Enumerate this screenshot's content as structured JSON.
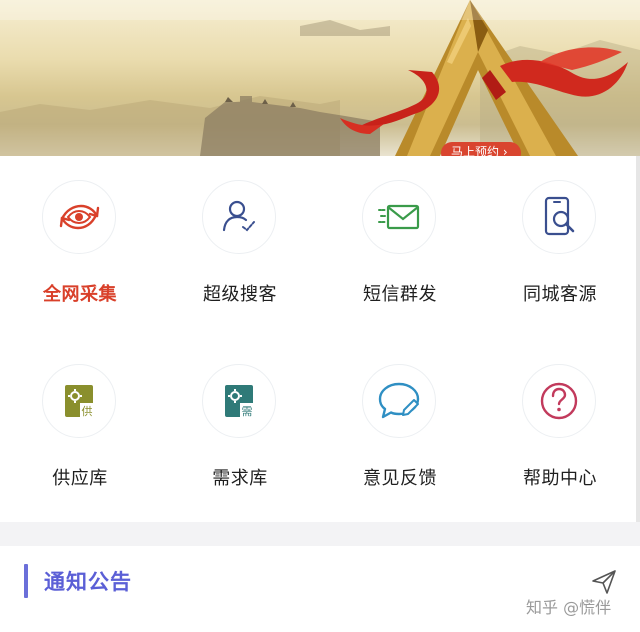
{
  "banner": {
    "button_label": "马上预约 ›"
  },
  "features": [
    {
      "label": "全网采集",
      "icon": "eye-refresh-icon",
      "active": true
    },
    {
      "label": "超级搜客",
      "icon": "user-check-icon",
      "active": false
    },
    {
      "label": "短信群发",
      "icon": "envelope-icon",
      "active": false
    },
    {
      "label": "同城客源",
      "icon": "phone-search-icon",
      "active": false
    },
    {
      "label": "供应库",
      "icon": "supply-library-icon",
      "badge": "供",
      "active": false
    },
    {
      "label": "需求库",
      "icon": "demand-library-icon",
      "badge": "需",
      "active": false
    },
    {
      "label": "意见反馈",
      "icon": "feedback-bubble-icon",
      "active": false
    },
    {
      "label": "帮助中心",
      "icon": "help-question-icon",
      "active": false
    }
  ],
  "notice": {
    "title": "通知公告"
  },
  "watermark": "知乎 @慌伴",
  "colors": {
    "accent_red": "#d9402a",
    "notice_blue": "#5b5fd6",
    "feature_olive": "#8a8f2d",
    "feature_teal": "#2f7a78",
    "feature_green": "#3a9b4a",
    "feature_navy": "#3a4f8f",
    "feature_sky": "#2f8fc3",
    "feature_pink": "#c23a5c"
  }
}
